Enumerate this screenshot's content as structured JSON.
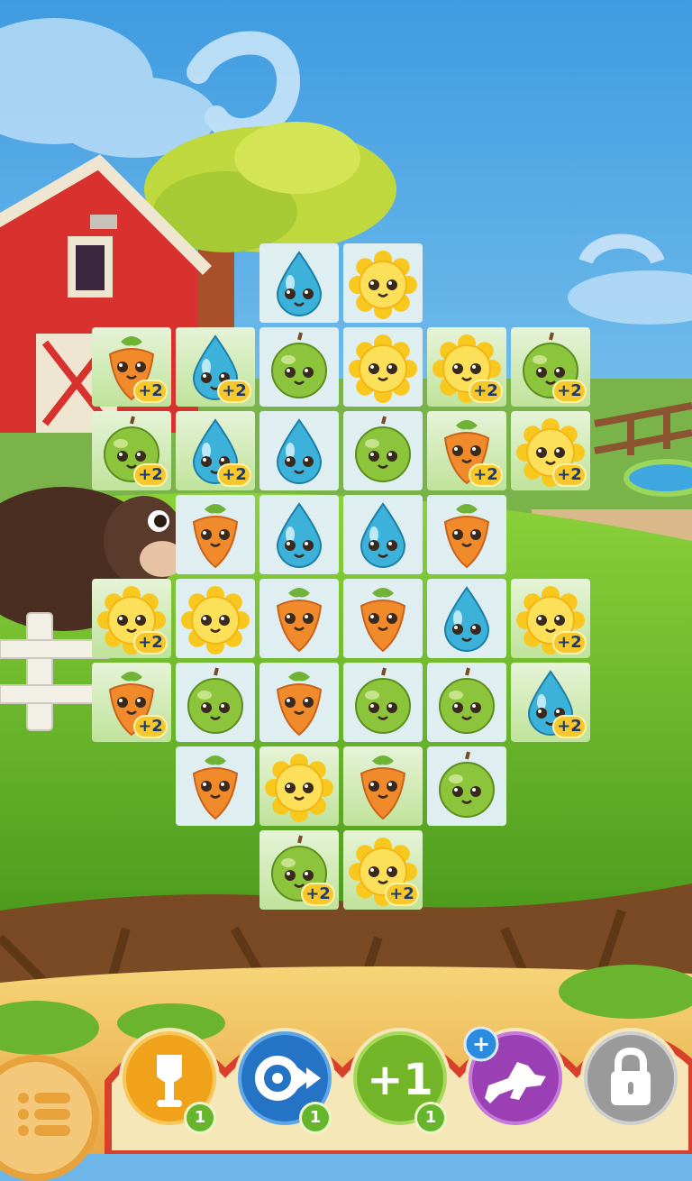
{
  "colors": {
    "sky": "#6fb6e8",
    "barn": "#d8312e",
    "grass": "#6fbf2e",
    "hud_orange": "#f0a21b",
    "hud_blue": "#2473c4",
    "hud_green": "#73b528",
    "hud_purple": "#9b3fb5",
    "hud_gray": "#9a9a9a"
  },
  "board": {
    "rows": [
      [
        null,
        null,
        {
          "crop": "water",
          "grass": false
        },
        {
          "crop": "sun",
          "grass": false
        },
        null,
        null
      ],
      [
        {
          "crop": "carrot",
          "grass": true,
          "bonus": "+2"
        },
        {
          "crop": "water",
          "grass": true,
          "bonus": "+2"
        },
        {
          "crop": "apple",
          "grass": false
        },
        {
          "crop": "sun",
          "grass": false
        },
        {
          "crop": "sun",
          "grass": true,
          "bonus": "+2"
        },
        {
          "crop": "apple",
          "grass": true,
          "bonus": "+2"
        }
      ],
      [
        {
          "crop": "apple",
          "grass": true,
          "bonus": "+2"
        },
        {
          "crop": "water",
          "grass": true,
          "bonus": "+2"
        },
        {
          "crop": "water",
          "grass": false
        },
        {
          "crop": "apple",
          "grass": false
        },
        {
          "crop": "carrot",
          "grass": true,
          "bonus": "+2"
        },
        {
          "crop": "sun",
          "grass": true,
          "bonus": "+2"
        }
      ],
      [
        null,
        {
          "crop": "carrot",
          "grass": false
        },
        {
          "crop": "water",
          "grass": false
        },
        {
          "crop": "water",
          "grass": false
        },
        {
          "crop": "carrot",
          "grass": false
        },
        null
      ],
      [
        {
          "crop": "sun",
          "grass": true,
          "bonus": "+2"
        },
        {
          "crop": "sun",
          "grass": false
        },
        {
          "crop": "carrot",
          "grass": false
        },
        {
          "crop": "carrot",
          "grass": false
        },
        {
          "crop": "water",
          "grass": false
        },
        {
          "crop": "sun",
          "grass": true,
          "bonus": "+2"
        }
      ],
      [
        {
          "crop": "carrot",
          "grass": true,
          "bonus": "+2"
        },
        {
          "crop": "apple",
          "grass": false
        },
        {
          "crop": "carrot",
          "grass": false
        },
        {
          "crop": "apple",
          "grass": false
        },
        {
          "crop": "apple",
          "grass": false
        },
        {
          "crop": "water",
          "grass": true,
          "bonus": "+2"
        }
      ],
      [
        null,
        {
          "crop": "carrot",
          "grass": false
        },
        {
          "crop": "sun",
          "grass": true
        },
        {
          "crop": "carrot",
          "grass": true
        },
        {
          "crop": "apple",
          "grass": false
        },
        null
      ],
      [
        null,
        null,
        {
          "crop": "apple",
          "grass": true,
          "bonus": "+2"
        },
        {
          "crop": "sun",
          "grass": true,
          "bonus": "+2"
        },
        null,
        null
      ]
    ]
  },
  "boosters": [
    {
      "name": "shovel",
      "icon": "shovel-icon",
      "count": "1"
    },
    {
      "name": "tractor",
      "icon": "tractor-icon",
      "count": "1"
    },
    {
      "name": "plus-one",
      "icon": "plus-one-icon",
      "label": "+1",
      "count": "1"
    },
    {
      "name": "dog",
      "icon": "dog-icon",
      "badge": "+"
    },
    {
      "name": "locked",
      "icon": "padlock-icon"
    }
  ],
  "menu": {
    "icon": "menu-list-icon"
  }
}
